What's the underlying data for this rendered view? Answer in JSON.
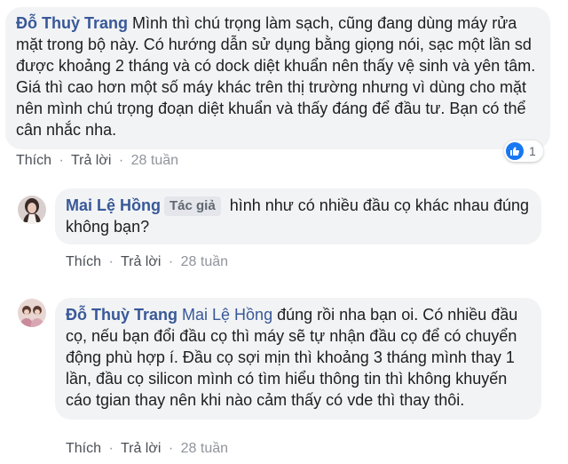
{
  "comments": [
    {
      "author": "Đỗ Thuỳ Trang",
      "text": " Mình thì chú trọng làm sạch, cũng đang dùng máy rửa mặt trong bộ này. Có hướng dẫn sử dụng bằng giọng nói, sạc một lần sd được khoảng 2 tháng và có dock diệt khuẩn nên thấy vệ sinh và yên tâm. Giá thì cao hơn một số máy khác trên thị trường nhưng vì dùng cho mặt nên mình chú trọng đoạn diệt khuẩn và thấy đáng để đầu tư. Bạn có thể cân nhắc nha.",
      "like_label": "Thích",
      "reply_label": "Trả lời",
      "time": "28 tuần",
      "reaction_count": "1"
    },
    {
      "author": "Mai Lệ Hồng",
      "author_badge": "Tác giả",
      "text": "hình như có nhiều đầu cọ khác nhau đúng không bạn?",
      "like_label": "Thích",
      "reply_label": "Trả lời",
      "time": "28 tuần"
    },
    {
      "author": "Đỗ Thuỳ Trang",
      "mention": "Mai Lệ Hồng",
      "text": " đúng rồi nha bạn oi. Có nhiều đầu cọ, nếu bạn đổi đầu cọ thì máy sẽ tự nhận đầu cọ để có chuyển động phù hợp í. Đầu cọ sợi mịn thì khoảng 3 tháng mình thay 1 lần, đầu cọ silicon mình có tìm hiểu thông tin thì không khuyến cáo tgian thay nên khi nào cảm thấy có vde thì thay thôi.",
      "like_label": "Thích",
      "reply_label": "Trả lời",
      "time": "28 tuần"
    }
  ],
  "separator": "·",
  "colors": {
    "author": "#385898",
    "bubble": "#f2f3f5",
    "meta": "#90949c",
    "like_blue": "#1877f2"
  }
}
